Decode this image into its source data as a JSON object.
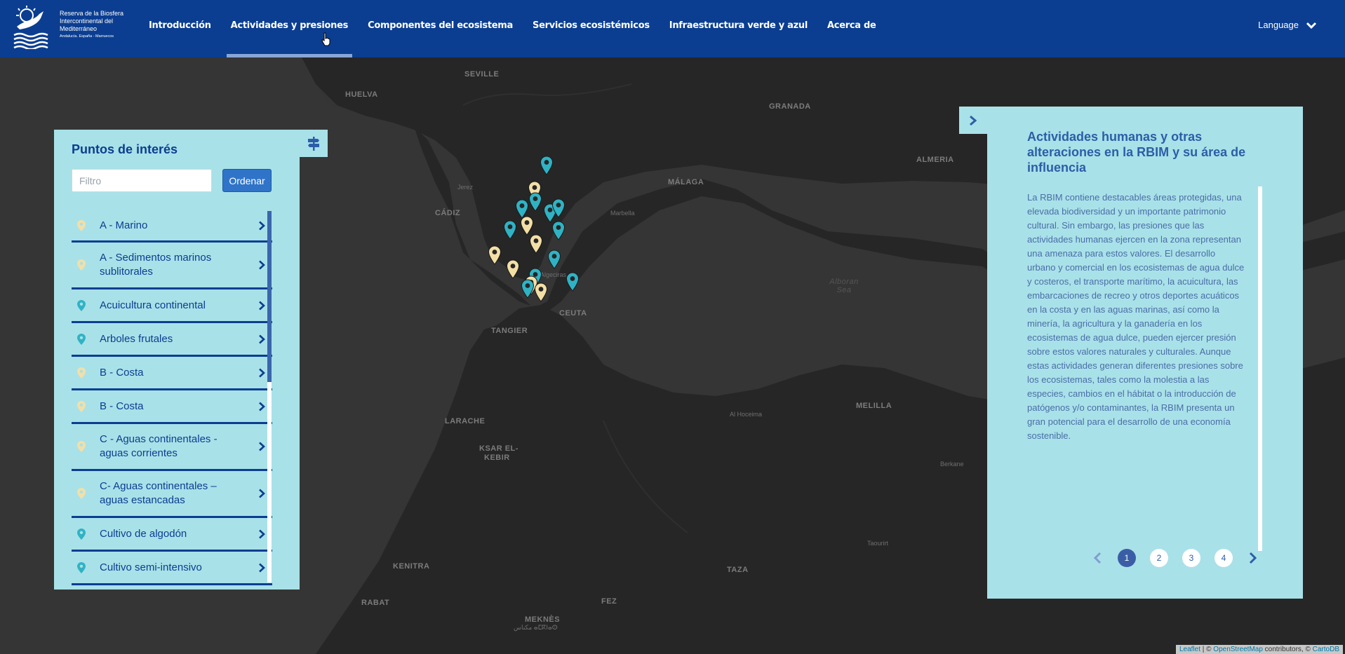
{
  "header": {
    "logo": {
      "line1": "Reserva de la Biosfera",
      "line2": "Intercontinental del",
      "line3": "Mediterráneo",
      "line4": "Andalucía. España - Marruecos"
    },
    "nav": [
      {
        "label": "Introducción"
      },
      {
        "label": "Actividades y presiones"
      },
      {
        "label": "Componentes del ecosistema"
      },
      {
        "label": "Servicios ecosistémicos"
      },
      {
        "label": "Infraestructura verde y azul"
      },
      {
        "label": "Acerca de"
      }
    ],
    "active_nav": "Actividades y presiones",
    "language_label": "Language"
  },
  "map": {
    "labels": [
      {
        "text": "SEVILLE"
      },
      {
        "text": "HUELVA"
      },
      {
        "text": "GRANADA"
      },
      {
        "text": "ALMERIA"
      },
      {
        "text": "MÁLAGA"
      },
      {
        "text": "Marbella"
      },
      {
        "text": "Jerez"
      },
      {
        "text": "CÁDIZ"
      },
      {
        "text": "CEUTA"
      },
      {
        "text": "Algeciras"
      },
      {
        "text": "TANGIER"
      },
      {
        "text": "LARACHE"
      },
      {
        "text": "KSAR EL-"
      },
      {
        "text": "KEBIR"
      },
      {
        "text": "Al Hoceima"
      },
      {
        "text": "MELILLA"
      },
      {
        "text": "Berkane"
      },
      {
        "text": "Taourirt"
      },
      {
        "text": "KENITRA"
      },
      {
        "text": "TAZA"
      },
      {
        "text": "RABAT"
      },
      {
        "text": "FEZ"
      },
      {
        "text": "MEKNÈS"
      },
      {
        "text": "مكناس ⴰⵎⴽⵏⴰⵙ"
      },
      {
        "text": "Alboran Sea"
      }
    ],
    "marker_colors": {
      "teal": "#2fb3c4",
      "cream": "#f3dfa6"
    },
    "attribution": {
      "leaflet": "Leaflet",
      "sep": " | © ",
      "osm": "OpenStreetMap",
      "contrib": " contributors, © ",
      "carto": "CartoDB"
    }
  },
  "poi_panel": {
    "title": "Puntos de interés",
    "filter_placeholder": "Filtro",
    "order_label": "Ordenar",
    "items": [
      {
        "label": "A - Marino",
        "pin": "cream"
      },
      {
        "label": "A - Sedimentos marinos sublitorales",
        "pin": "cream"
      },
      {
        "label": "Acuicultura continental",
        "pin": "teal"
      },
      {
        "label": "Arboles frutales",
        "pin": "teal"
      },
      {
        "label": "B - Costa",
        "pin": "cream"
      },
      {
        "label": "B - Costa",
        "pin": "cream"
      },
      {
        "label": "C - Aguas continentales - aguas corrientes",
        "pin": "cream"
      },
      {
        "label": "C- Aguas continentales – aguas estancadas",
        "pin": "cream"
      },
      {
        "label": "Cultivo de algodón",
        "pin": "teal"
      },
      {
        "label": "Cultivo semi-intensivo",
        "pin": "teal"
      }
    ]
  },
  "info_panel": {
    "title": "Actividades humanas y otras alteraciones en la RBIM y su área de influencia",
    "body": "La RBIM contiene destacables áreas protegidas, una elevada biodiversidad y un importante patrimonio cultural. Sin embargo, las presiones que las actividades humanas ejercen en la zona representan una amenaza para estos valores. El desarrollo urbano y comercial en los ecosistemas de agua dulce y costeros, el transporte marítimo, la acuicultura, las embarcaciones de recreo y otros deportes acuáticos en la costa y en las aguas marinas, así como la minería, la agricultura y la ganadería en los ecosistemas de agua dulce, pueden ejercer presión sobre estos valores naturales y culturales. Aunque estas actividades generan diferentes presiones sobre los ecosistemas, tales como la molestia a las especies, cambios en el hábitat o la introducción de patógenos y/o contaminantes, la RBIM presenta un gran potencial para el desarrollo de una economía sostenible.",
    "pages": [
      "1",
      "2",
      "3",
      "4"
    ],
    "current_page": "1"
  }
}
